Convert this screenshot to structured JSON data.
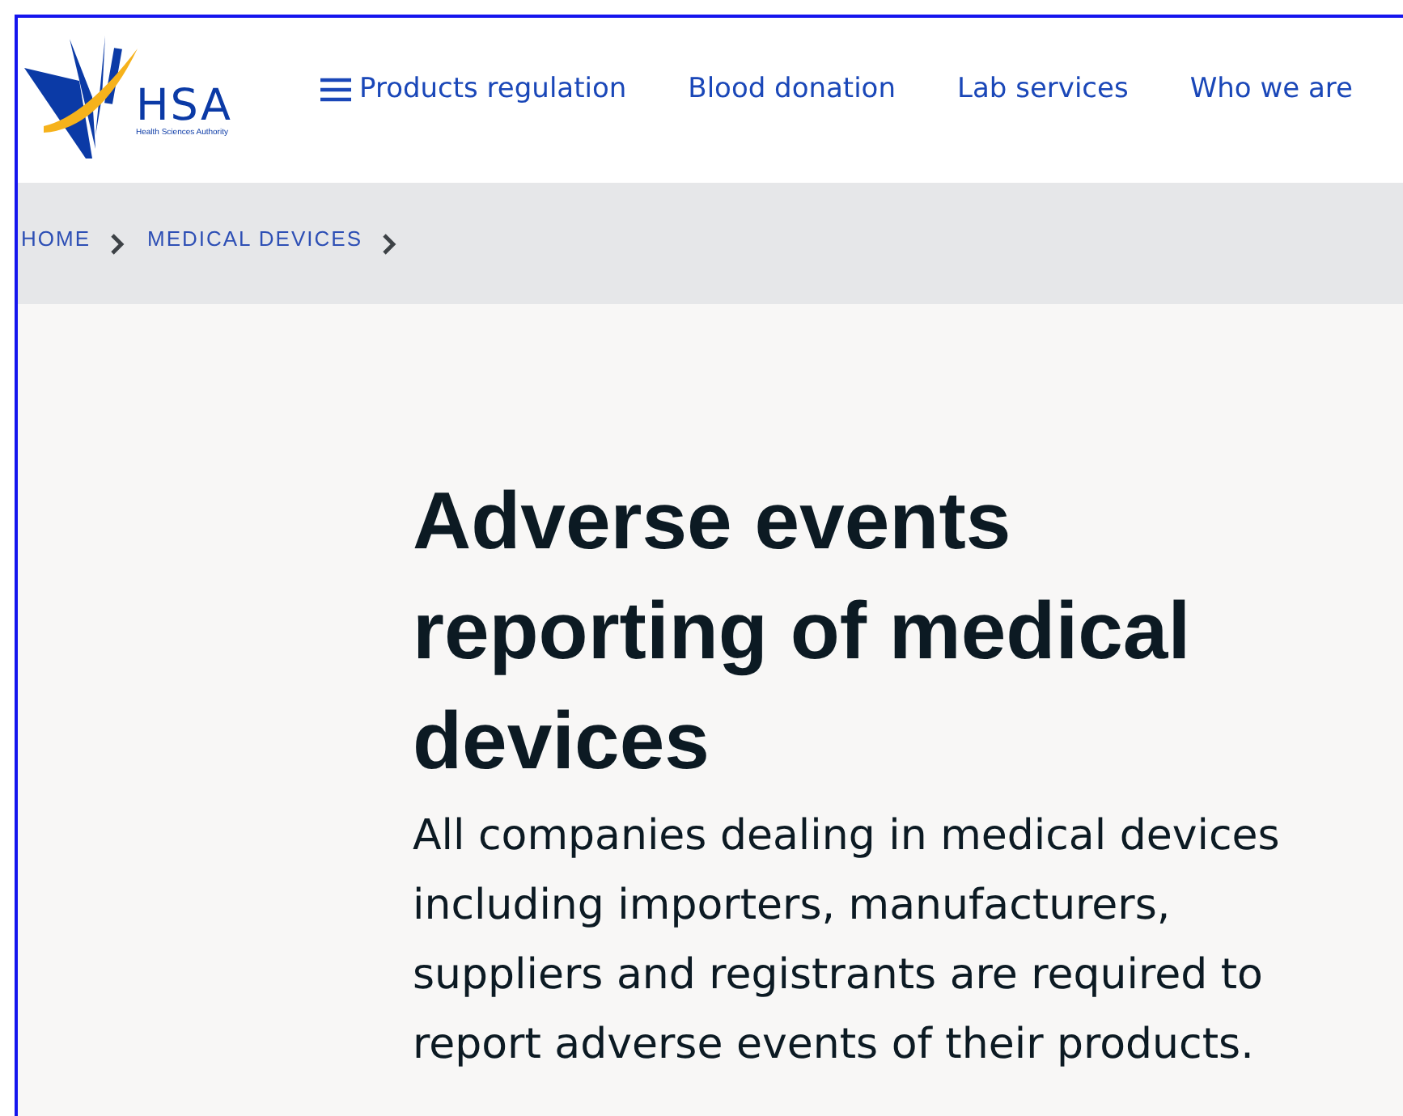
{
  "logo": {
    "name": "HSA",
    "subtitle": "Health Sciences Authority"
  },
  "nav": [
    {
      "label": "Products regulation",
      "kind": "menu"
    },
    {
      "label": "Blood donation",
      "kind": "link"
    },
    {
      "label": "Lab services",
      "kind": "link"
    },
    {
      "label": "Who we are",
      "kind": "link"
    }
  ],
  "breadcrumb": [
    "HOME",
    "MEDICAL DEVICES"
  ],
  "title": "Adverse events reporting of medical devices",
  "intro": "All companies dealing in medical devices including importers, manufacturers, suppliers and registrants are required to report adverse events of their products."
}
